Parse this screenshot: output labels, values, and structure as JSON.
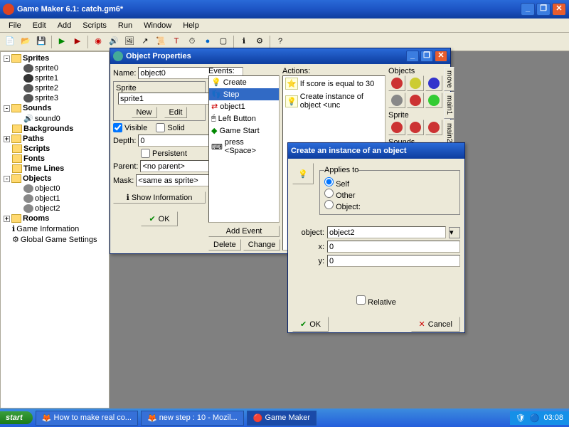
{
  "app": {
    "title": "Game Maker 6.1: catch.gm6*"
  },
  "menu": [
    "File",
    "Edit",
    "Add",
    "Scripts",
    "Run",
    "Window",
    "Help"
  ],
  "tree": {
    "sprites": {
      "label": "Sprites",
      "items": [
        "sprite0",
        "sprite1",
        "sprite2",
        "sprite3"
      ]
    },
    "sounds": {
      "label": "Sounds",
      "items": [
        "sound0"
      ]
    },
    "backgrounds": {
      "label": "Backgrounds"
    },
    "paths": {
      "label": "Paths"
    },
    "scripts": {
      "label": "Scripts"
    },
    "fonts": {
      "label": "Fonts"
    },
    "timelines": {
      "label": "Time Lines"
    },
    "objects": {
      "label": "Objects",
      "items": [
        "object0",
        "object1",
        "object2"
      ]
    },
    "rooms": {
      "label": "Rooms"
    },
    "gameinfo": {
      "label": "Game Information"
    },
    "settings": {
      "label": "Global Game Settings"
    }
  },
  "objprops": {
    "title": "Object Properties",
    "name_label": "Name:",
    "name_value": "object0",
    "sprite_label": "Sprite",
    "sprite_value": "sprite1",
    "new_btn": "New",
    "edit_btn": "Edit",
    "visible": "Visible",
    "solid": "Solid",
    "depth_label": "Depth:",
    "depth_value": "0",
    "persistent": "Persistent",
    "parent_label": "Parent:",
    "parent_value": "<no parent>",
    "mask_label": "Mask:",
    "mask_value": "<same as sprite>",
    "showinfo": "Show Information",
    "ok": "OK",
    "events_label": "Events:",
    "events": [
      "Create",
      "Step",
      "object1",
      "Left Button",
      "Game Start",
      "press <Space>"
    ],
    "addevent": "Add Event",
    "delete": "Delete",
    "change": "Change",
    "actions_label": "Actions:",
    "actions": [
      "If score is equal to 30",
      "Create instance of object <unc"
    ],
    "pal_objects": "Objects",
    "pal_sprite": "Sprite",
    "pal_sounds": "Sounds",
    "vtabs": [
      "move",
      "main1",
      "main2"
    ]
  },
  "instdlg": {
    "title": "Create an instance of an object",
    "applies_to": "Applies to",
    "self": "Self",
    "other": "Other",
    "object_radio": "Object:",
    "object_label": "object:",
    "object_value": "object2",
    "x_label": "x:",
    "x_value": "0",
    "y_label": "y:",
    "y_value": "0",
    "relative": "Relative",
    "ok": "OK",
    "cancel": "Cancel"
  },
  "taskbar": {
    "start": "start",
    "tasks": [
      "How to make real co...",
      "new step : 10 - Mozil...",
      "Game Maker"
    ],
    "time": "03:08"
  }
}
